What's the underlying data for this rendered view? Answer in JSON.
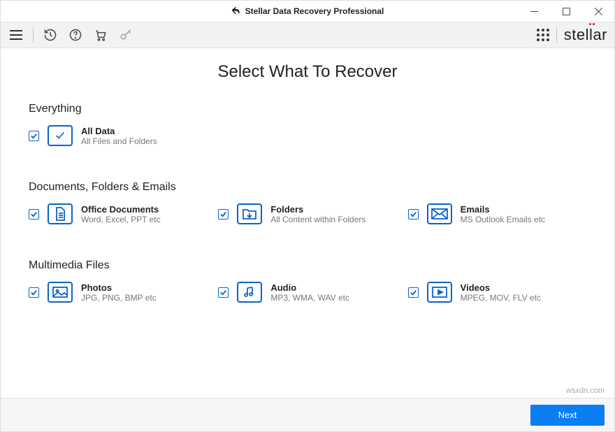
{
  "window": {
    "title": "Stellar Data Recovery Professional"
  },
  "brand": "stellar",
  "page_heading": "Select What To Recover",
  "sections": {
    "everything": {
      "heading": "Everything",
      "items": [
        {
          "title": "All Data",
          "sub": "All Files and Folders"
        }
      ]
    },
    "docs": {
      "heading": "Documents, Folders & Emails",
      "items": [
        {
          "title": "Office Documents",
          "sub": "Word, Excel, PPT etc"
        },
        {
          "title": "Folders",
          "sub": "All Content within Folders"
        },
        {
          "title": "Emails",
          "sub": "MS Outlook Emails etc"
        }
      ]
    },
    "media": {
      "heading": "Multimedia Files",
      "items": [
        {
          "title": "Photos",
          "sub": "JPG, PNG, BMP etc"
        },
        {
          "title": "Audio",
          "sub": "MP3, WMA, WAV etc"
        },
        {
          "title": "Videos",
          "sub": "MPEG, MOV, FLV etc"
        }
      ]
    }
  },
  "buttons": {
    "next": "Next"
  },
  "watermark": "wsxdn.com",
  "colors": {
    "accent": "#0a64c8",
    "primary_button": "#0a7ef2"
  }
}
